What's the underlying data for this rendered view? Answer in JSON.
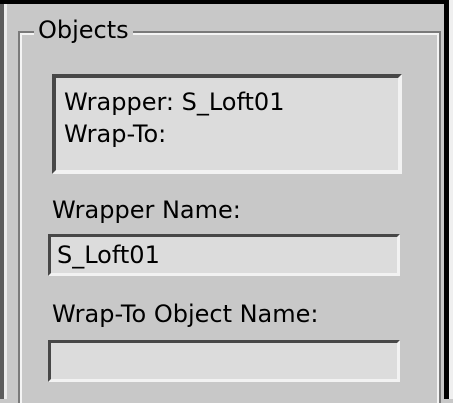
{
  "group": {
    "title": "Objects"
  },
  "info": {
    "wrapper_line": "Wrapper: S_Loft01",
    "wrapto_line": "Wrap-To:"
  },
  "wrapper_name": {
    "label": "Wrapper Name:",
    "value": "S_Loft01"
  },
  "wrapto_name": {
    "label": "Wrap-To Object Name:",
    "value": ""
  },
  "colors": {
    "panel_bg": "#c8c8c8",
    "field_bg": "#dcdcdc",
    "text": "#000000"
  }
}
